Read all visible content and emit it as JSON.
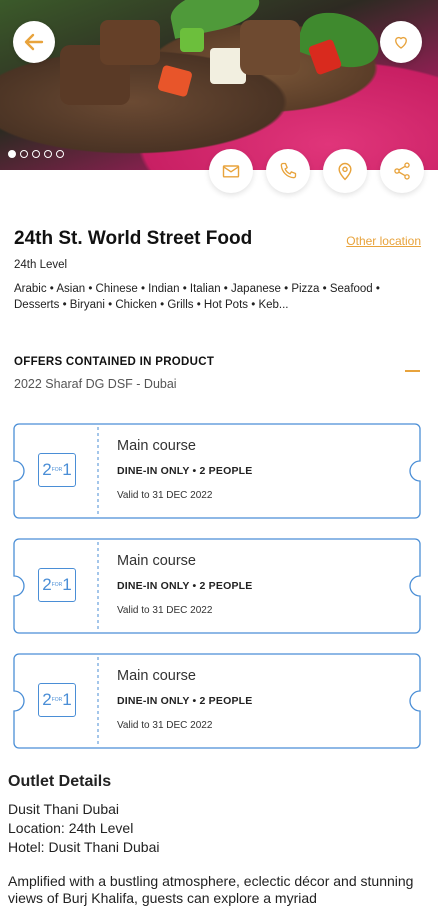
{
  "hero": {
    "dots_total": 5,
    "dots_active_index": 0
  },
  "restaurant": {
    "name": "24th St. World Street Food",
    "other_location": "Other location",
    "level": "24th Level",
    "cuisines": "Arabic • Asian • Chinese • Indian • Italian • Japanese • Pizza • Seafood • Desserts • Biryani • Chicken • Grills • Hot Pots • Keb..."
  },
  "offers": {
    "heading": "OFFERS CONTAINED IN PRODUCT",
    "product": "2022 Sharaf DG DSF - Dubai",
    "items": [
      {
        "badge_left": "2",
        "badge_mid": "FOR",
        "badge_right": "1",
        "title": "Main course",
        "conditions": "DINE-IN ONLY • 2 PEOPLE",
        "validity": "Valid to 31 DEC 2022"
      },
      {
        "badge_left": "2",
        "badge_mid": "FOR",
        "badge_right": "1",
        "title": "Main course",
        "conditions": "DINE-IN ONLY • 2 PEOPLE",
        "validity": "Valid to 31 DEC 2022"
      },
      {
        "badge_left": "2",
        "badge_mid": "FOR",
        "badge_right": "1",
        "title": "Main course",
        "conditions": "DINE-IN ONLY • 2 PEOPLE",
        "validity": "Valid to 31 DEC 2022"
      }
    ]
  },
  "outlet": {
    "heading": "Outlet Details",
    "name": "Dusit Thani Dubai",
    "location": "Location: 24th Level",
    "hotel": "Hotel: Dusit Thani Dubai",
    "description": "Amplified with a bustling atmosphere, eclectic décor and stunning views of Burj Khalifa, guests can explore a myriad"
  },
  "icons": {
    "back": "arrow-left-icon",
    "favorite": "heart-icon",
    "email": "mail-icon",
    "phone": "phone-icon",
    "location": "map-pin-icon",
    "share": "share-icon"
  },
  "colors": {
    "accent": "#e8a33c",
    "coupon_border": "#4a8ed6"
  }
}
